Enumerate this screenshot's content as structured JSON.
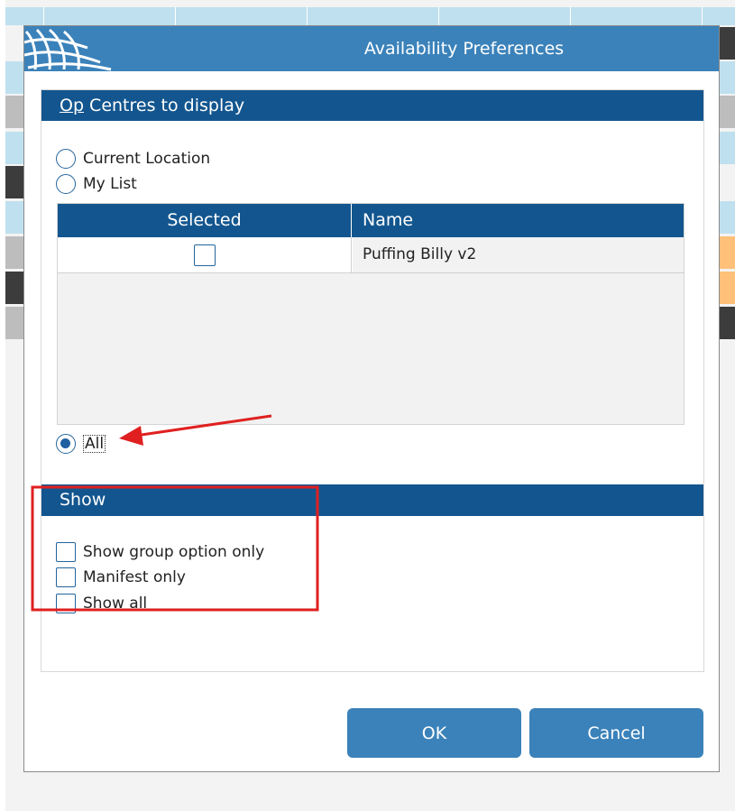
{
  "dialog": {
    "title": "Availability Preferences"
  },
  "op_centres": {
    "header_prefix": "Op",
    "header_rest": " Centres to display",
    "options": [
      {
        "label": "Current Location",
        "checked": false
      },
      {
        "label": "My List",
        "checked": false
      },
      {
        "label": "All",
        "checked": true
      }
    ],
    "grid": {
      "columns": [
        "Selected",
        "Name"
      ],
      "rows": [
        {
          "selected": false,
          "name": "Puffing Billy v2"
        }
      ]
    }
  },
  "show": {
    "header": "Show",
    "options": [
      {
        "label": "Show group option only",
        "checked": false
      },
      {
        "label": "Manifest only",
        "checked": false
      },
      {
        "label": "Show all",
        "checked": false
      }
    ]
  },
  "buttons": {
    "ok_label": "OK",
    "cancel_label": "Cancel"
  },
  "colors": {
    "accent": "#3b82ba",
    "header": "#13568f",
    "annotation": "#e02020"
  },
  "icons": {
    "logo": "globe-logo-icon",
    "annotation_arrow": "arrow-left-icon"
  }
}
